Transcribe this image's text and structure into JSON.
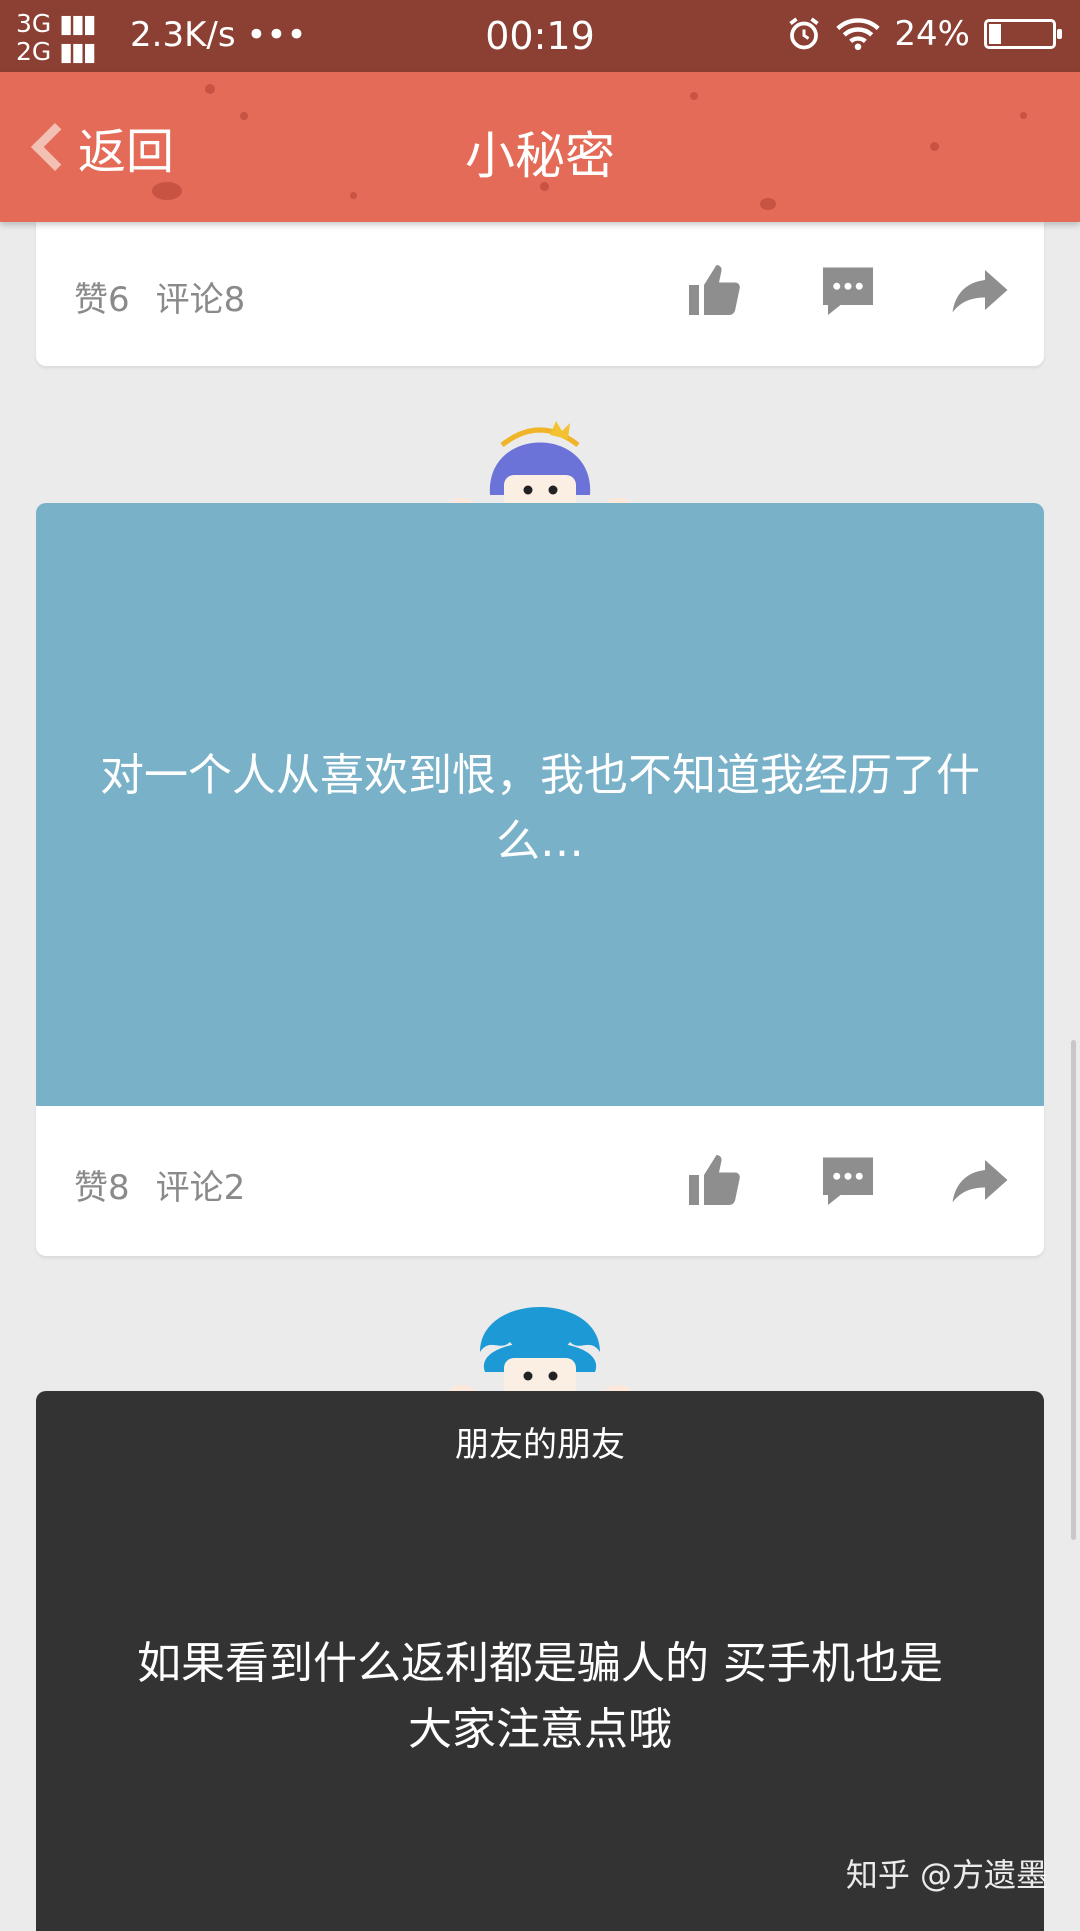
{
  "status_bar": {
    "network_top": "3G",
    "network_bottom": "2G",
    "speed": "2.3K/s",
    "more": "•••",
    "time": "00:19",
    "battery": "24%"
  },
  "header": {
    "back_label": "返回",
    "title": "小秘密"
  },
  "posts": [
    {
      "likes": "赞6",
      "comments": "评论8"
    },
    {
      "text": "对一个人从喜欢到恨，我也不知道我经历了什么…",
      "likes": "赞8",
      "comments": "评论2",
      "bg": "#79b1c8"
    },
    {
      "tag": "朋友的朋友",
      "text": "如果看到什么返利都是骗人的 买手机也是 大家注意点哦",
      "bg": "#333333"
    }
  ],
  "watermark": "知乎 @方遗墨",
  "colors": {
    "status": "#8c3f33",
    "header": "#e36b57",
    "icon_gray": "#8e8e8e"
  }
}
